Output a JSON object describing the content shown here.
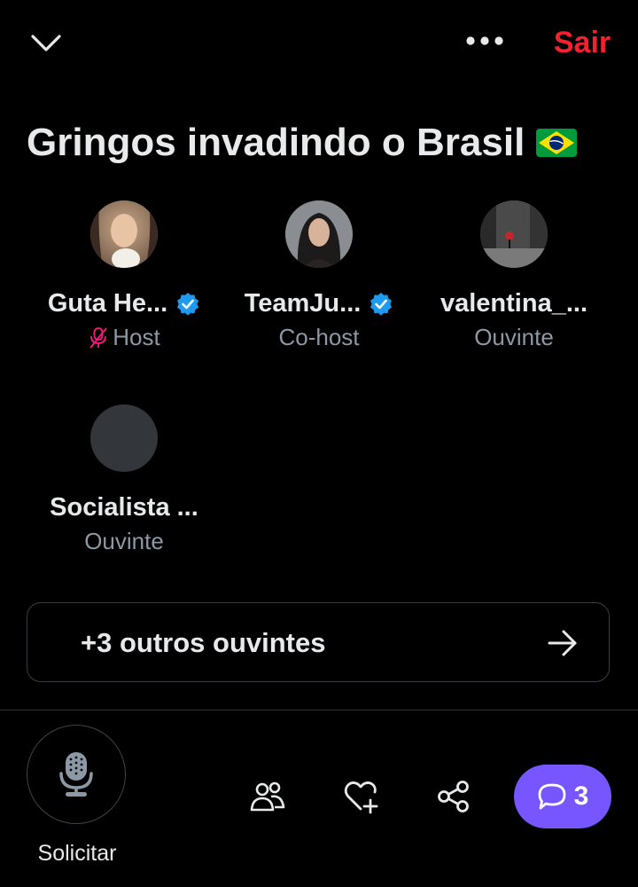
{
  "header": {
    "leave_label": "Sair",
    "leave_color": "#f4212e",
    "collapse_icon": "chevron-down-icon",
    "more_icon": "more-horizontal-icon"
  },
  "space": {
    "title": "Gringos invadindo o Brasil",
    "title_emoji": "brazil-flag-icon"
  },
  "participants": [
    {
      "name": "Guta He...",
      "verified": true,
      "role": "Host",
      "muted": true
    },
    {
      "name": "TeamJu...",
      "verified": true,
      "role": "Co-host",
      "muted": false
    },
    {
      "name": "valentina_...",
      "verified": false,
      "role": "Ouvinte",
      "muted": false
    },
    {
      "name": "Socialista ...",
      "verified": false,
      "role": "Ouvinte",
      "muted": false
    }
  ],
  "listeners": {
    "label": "+3 outros ouvintes",
    "icon": "arrow-right-icon"
  },
  "bottom_bar": {
    "request_label": "Solicitar",
    "request_icon": "microphone-icon",
    "people_icon": "people-icon",
    "like_icon": "heart-plus-icon",
    "share_icon": "share-icon",
    "comments_count": "3",
    "comments_icon": "comment-bubble-icon",
    "comments_color": "#7856ff"
  },
  "colors": {
    "background": "#000000",
    "verified": "#1d9bf0",
    "muted_mic": "#f91880",
    "secondary_text": "#8b98a5"
  }
}
